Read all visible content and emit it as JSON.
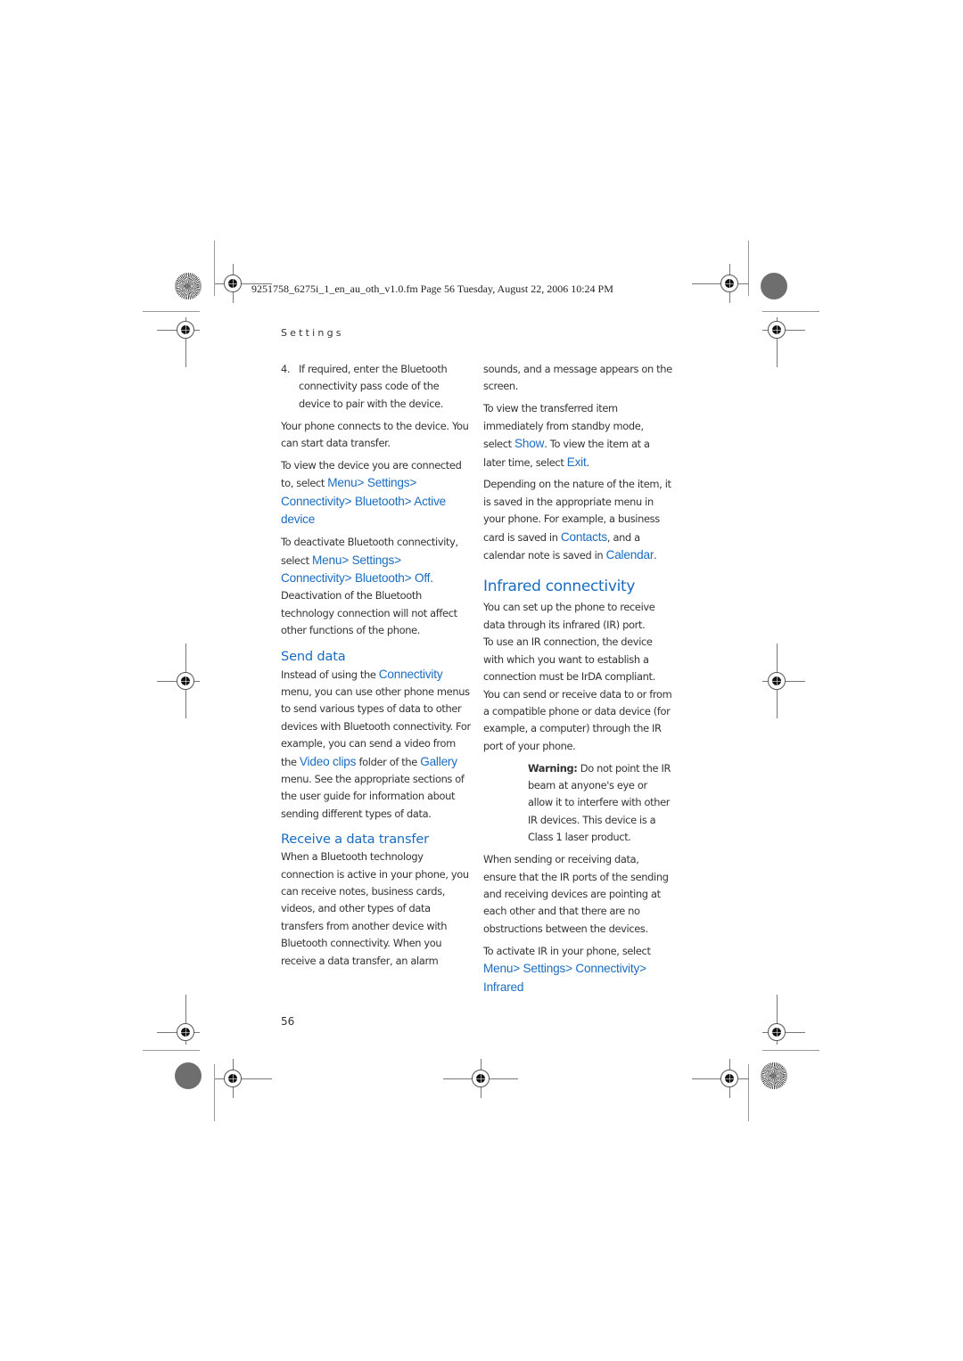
{
  "slug": "9251758_6275i_1_en_au_oth_v1.0.fm  Page 56  Tuesday, August 22, 2006  10:24 PM",
  "running_head": "Settings",
  "folio": "56",
  "left_column": {
    "step": {
      "number": "4.",
      "text": "If required, enter the Bluetooth connectivity pass code of the device to pair with the device."
    },
    "para_connects": "Your phone connects to the device. You can start data transfer.",
    "para_view_device": {
      "prefix": "To view the device you are connected to, select ",
      "path": [
        "Menu",
        "Settings",
        "Connectivity",
        "Bluetooth",
        "Active device"
      ],
      "separator": " > "
    },
    "para_deactivate": {
      "prefix": "To deactivate Bluetooth connectivity, select ",
      "path": [
        "Menu",
        "Settings",
        "Connectivity",
        "Bluetooth",
        "Off"
      ],
      "suffix": ".",
      "after": "Deactivation of the Bluetooth technology connection will not affect other functions of the phone."
    },
    "send_data": {
      "heading": "Send data",
      "t1": "Instead of using the ",
      "l1": "Connectivity",
      "t2": " menu, you can use other phone menus to send various types of data to other devices with Bluetooth connectivity. For example, you can send a video from the ",
      "l2": "Video clips",
      "t3": " folder of the ",
      "l3": "Gallery",
      "t4": " menu. See the appropriate sections of the user guide for information about sending different types of data."
    },
    "receive": {
      "heading": "Receive a data transfer",
      "text": "When a Bluetooth technology connection is active in your phone, you can receive notes, business cards, videos, and other types of data transfers from another device with Bluetooth connectivity. When you receive a data transfer, an alarm"
    }
  },
  "right_column": {
    "para_continued": "sounds, and a message appears on the screen.",
    "para_view_item": {
      "t1": "To view the transferred item immediately from standby mode, select ",
      "l1": "Show",
      "t2": ". To view the item at a later time, select ",
      "l2": "Exit",
      "t3": "."
    },
    "para_nature": {
      "t1": "Depending on the nature of the item, it is saved in the appropriate menu in your phone. For example, a business card is saved in ",
      "l1": "Contacts",
      "t2": ", and a calendar note is saved in ",
      "l2": "Calendar",
      "t3": "."
    },
    "infrared": {
      "heading": "Infrared connectivity",
      "p1": "You can set up the phone to receive data through its infrared (IR) port.",
      "p2": "To use an IR connection, the device with which you want to establish a connection must be IrDA compliant.",
      "p3": "You can send or receive data to or from a compatible phone or data device (for example, a computer) through the IR port of your phone.",
      "warning_label": "Warning:",
      "warning_text": " Do not point the IR beam at anyone's eye or allow it to interfere with other IR devices. This device is a Class 1 laser product.",
      "p4": "When sending or receiving data, ensure that the IR ports of the sending and receiving devices are pointing at each other and that there are no obstructions between the devices.",
      "activate_prefix": "To activate IR in your phone, select ",
      "activate_path": [
        "Menu",
        "Settings",
        "Connectivity",
        "Infrared"
      ]
    }
  },
  "colors": {
    "link_blue": "#1a6cc0",
    "body_text": "#333333"
  }
}
